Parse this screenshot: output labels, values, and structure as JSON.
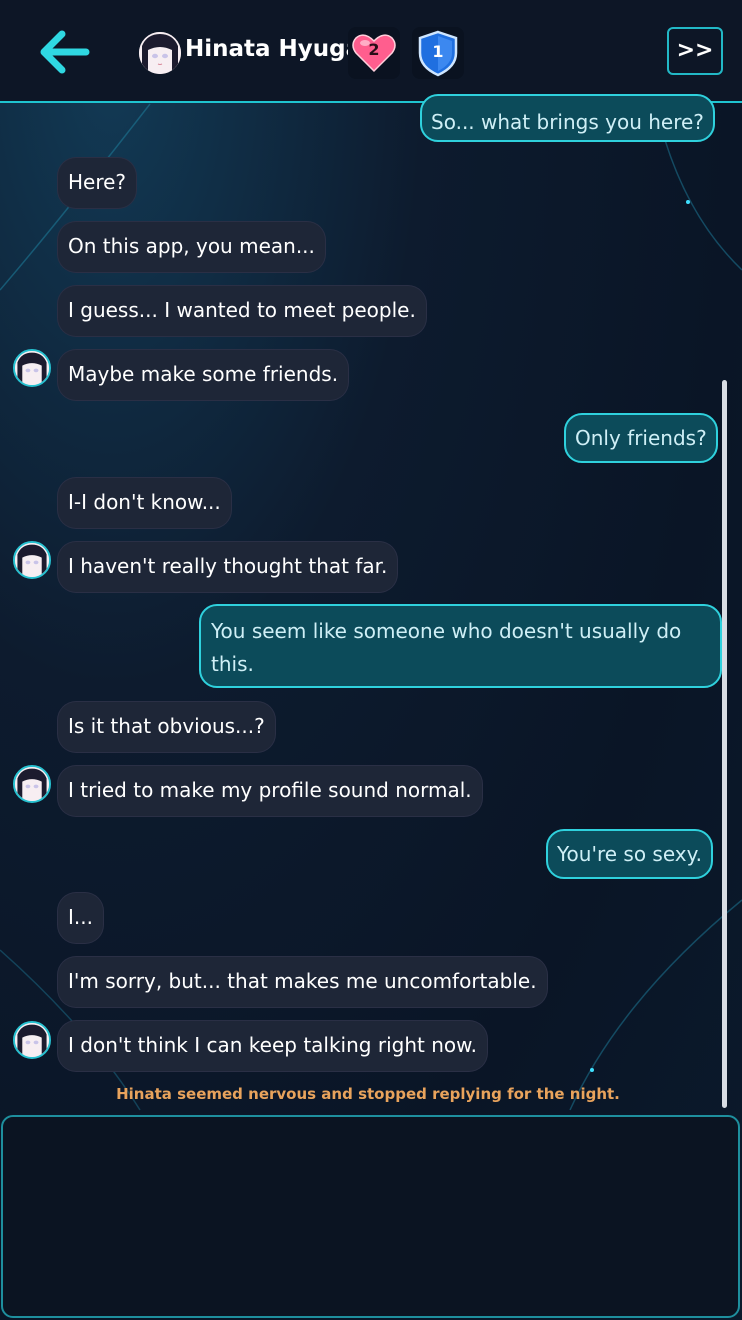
{
  "header": {
    "contact_name": "Hinata Hyuga",
    "heart_level": "2",
    "shield_level": "1",
    "skip_label": ">>",
    "back_icon": "arrow-left-icon"
  },
  "colors": {
    "accent": "#2fd1dd",
    "npc_bubble": "#1e2637",
    "player_bubble": "#0c4b5a",
    "system_text": "#e8a35c",
    "heart": "#ff5e8e",
    "shield": "#1f6fe0"
  },
  "messages": [
    {
      "from": "player",
      "text": "So... what brings you here?"
    },
    {
      "from": "npc",
      "text": "Here?"
    },
    {
      "from": "npc",
      "text": "On this app, you mean..."
    },
    {
      "from": "npc",
      "text": "I guess... I wanted to meet people."
    },
    {
      "from": "npc",
      "text": "Maybe make some friends."
    },
    {
      "from": "player",
      "text": "Only friends?"
    },
    {
      "from": "npc",
      "text": "I-I don't know..."
    },
    {
      "from": "npc",
      "text": "I haven't really thought that far."
    },
    {
      "from": "player",
      "text": "You seem like someone who doesn't usually do this."
    },
    {
      "from": "npc",
      "text": "Is it that obvious...?"
    },
    {
      "from": "npc",
      "text": "I tried to make my profile sound normal."
    },
    {
      "from": "player",
      "text": "You're so sexy."
    },
    {
      "from": "npc",
      "text": "I..."
    },
    {
      "from": "npc",
      "text": "I'm sorry, but... that makes me uncomfortable."
    },
    {
      "from": "npc",
      "text": "I don't think I can keep talking right now."
    }
  ],
  "system_note": "Hinata seemed nervous and stopped replying for the night."
}
